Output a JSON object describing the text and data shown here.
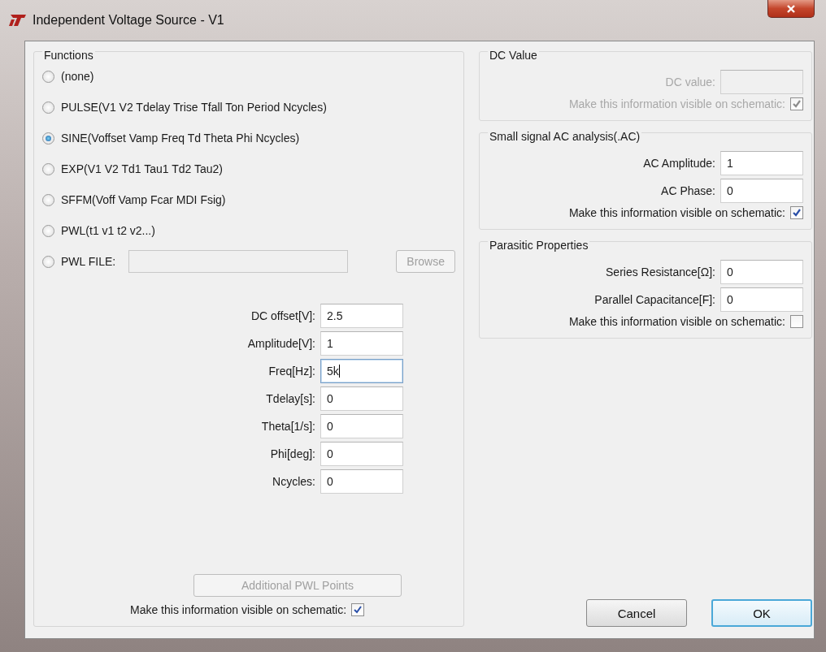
{
  "window": {
    "title": "Independent Voltage Source - V1"
  },
  "functions": {
    "title": "Functions",
    "options": [
      {
        "kind": "radio",
        "label": "(none)",
        "selected": false
      },
      {
        "kind": "radio",
        "label": "PULSE(V1 V2 Tdelay Trise Tfall Ton Period Ncycles)",
        "selected": false
      },
      {
        "kind": "radio",
        "label": "SINE(Voffset Vamp Freq Td Theta Phi Ncycles)",
        "selected": true
      },
      {
        "kind": "radio",
        "label": "EXP(V1 V2 Td1 Tau1 Td2 Tau2)",
        "selected": false
      },
      {
        "kind": "radio",
        "label": "SFFM(Voff Vamp Fcar MDI Fsig)",
        "selected": false
      },
      {
        "kind": "radio",
        "label": "PWL(t1 v1 t2 v2...)",
        "selected": false
      },
      {
        "kind": "file",
        "label": "PWL FILE:",
        "selected": false,
        "disabled": true,
        "button": {
          "label": "Browse",
          "disabled": true
        }
      }
    ],
    "parameters": [
      {
        "label": "DC offset[V]:",
        "value": "2.5",
        "focused": false
      },
      {
        "label": "Amplitude[V]:",
        "value": "1",
        "focused": false
      },
      {
        "label": "Freq[Hz]:",
        "value": "5k",
        "focused": true
      },
      {
        "label": "Tdelay[s]:",
        "value": "0",
        "focused": false
      },
      {
        "label": "Theta[1/s]:",
        "value": "0",
        "focused": false
      },
      {
        "label": "Phi[deg]:",
        "value": "0",
        "focused": false
      },
      {
        "label": "Ncycles:",
        "value": "0",
        "focused": false
      }
    ],
    "additional_button": {
      "label": "Additional PWL Points",
      "disabled": true
    },
    "visible": {
      "label": "Make this information visible on schematic:",
      "checked": true
    }
  },
  "groups": [
    {
      "title": "DC Value",
      "disabled": true,
      "fields": [
        {
          "label": "DC value:"
        }
      ],
      "visible": {
        "label": "Make this information visible on schematic:",
        "checked": true
      }
    },
    {
      "title": "Small signal AC analysis(.AC)",
      "disabled": false,
      "fields": [
        {
          "label": "AC Amplitude:",
          "value": "1"
        },
        {
          "label": "AC Phase:",
          "value": "0"
        }
      ],
      "visible": {
        "label": "Make this information visible on schematic:",
        "checked": true
      }
    },
    {
      "title": "Parasitic Properties",
      "disabled": false,
      "fields": [
        {
          "label": "Series Resistance[Ω]:",
          "value": "0"
        },
        {
          "label": "Parallel Capacitance[F]:",
          "value": "0"
        }
      ],
      "visible": {
        "label": "Make this information visible on schematic:",
        "checked": false
      }
    }
  ],
  "buttons": [
    {
      "label": "Cancel",
      "default": false
    },
    {
      "label": "OK",
      "default": true
    }
  ]
}
